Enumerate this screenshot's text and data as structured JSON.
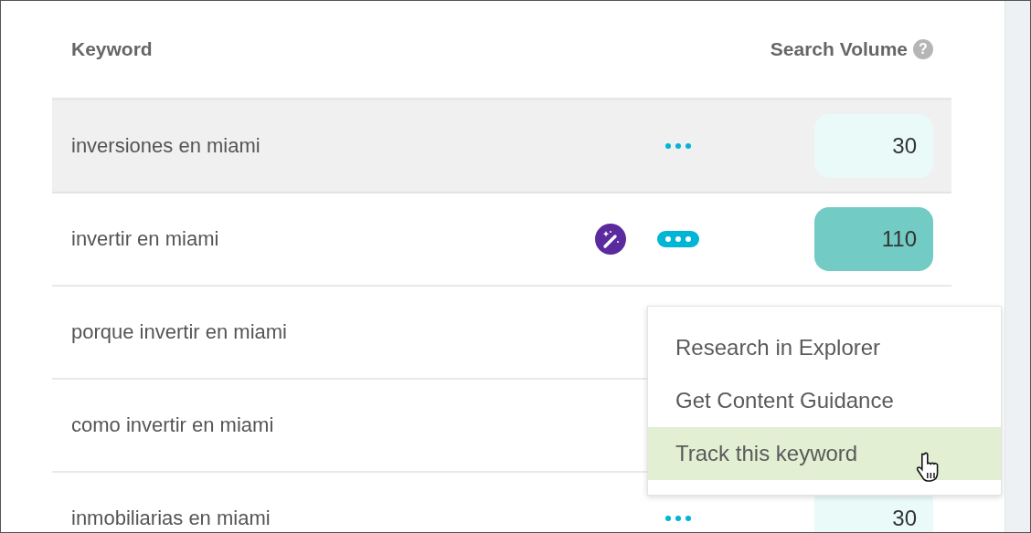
{
  "table": {
    "columns": [
      {
        "label": "Keyword"
      },
      {
        "label": "Search Volume",
        "help": "?"
      }
    ],
    "rows": [
      {
        "keyword": "inversiones en miami",
        "hovered": true,
        "menu_open": false,
        "volume": "30",
        "color": "#eafaf9"
      },
      {
        "keyword": "invertir en miami",
        "hovered": false,
        "menu_open": true,
        "volume": "110",
        "color": "#72cbc4"
      },
      {
        "keyword": "porque invertir en miami",
        "hovered": false
      },
      {
        "keyword": "como invertir en miami",
        "hovered": false
      },
      {
        "keyword": "inmobiliarias en miami",
        "hovered": false,
        "menu_open": false,
        "volume": "30",
        "color": "#eafaf9"
      }
    ]
  },
  "menu": {
    "items": [
      {
        "label": "Research in Explorer",
        "selected": false
      },
      {
        "label": "Get Content Guidance",
        "selected": false
      },
      {
        "label": "Track this keyword",
        "selected": true
      }
    ]
  }
}
